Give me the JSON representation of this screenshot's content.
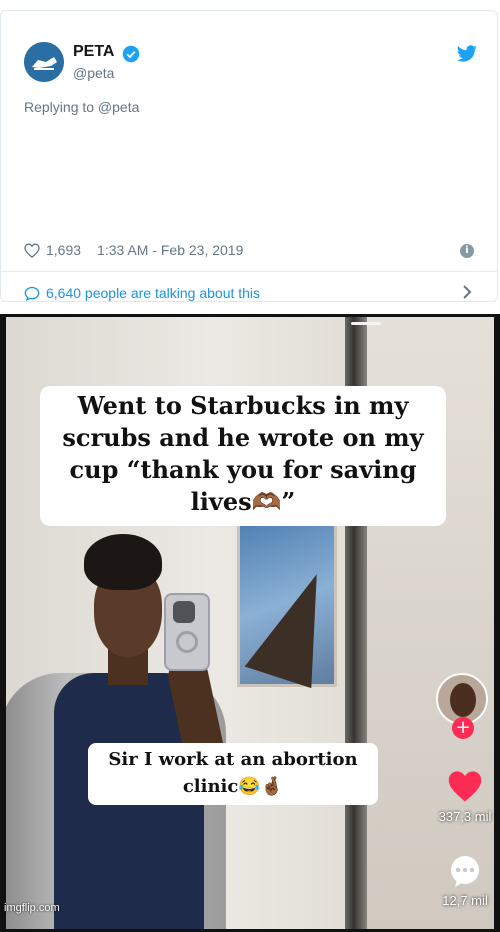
{
  "tweet": {
    "name": "PETA",
    "handle": "@peta",
    "reply_to": "Replying to @peta",
    "likes": "1,693",
    "timestamp": "1:33 AM - Feb 23, 2019",
    "talking": "6,640 people are talking about this",
    "accent": "#1b95e0",
    "icons": [
      "peta-logo-icon",
      "verified-badge-icon",
      "twitter-bird-icon",
      "heart-icon",
      "info-icon",
      "comment-icon",
      "chevron-right-icon"
    ]
  },
  "video": {
    "caption_top": "Went to Starbucks in my scrubs and he wrote on my cup “thank you for saving lives🫶🏾”",
    "caption_bottom": "Sir I work at an abortion clinic😂🤞🏾",
    "like_count": "337,3 mil",
    "comment_count": "12,7 mil",
    "accent": "#fe2c55",
    "icons": [
      "profile-avatar",
      "follow-plus-icon",
      "heart-icon",
      "comment-icon"
    ]
  },
  "watermark": "imgflip.com"
}
